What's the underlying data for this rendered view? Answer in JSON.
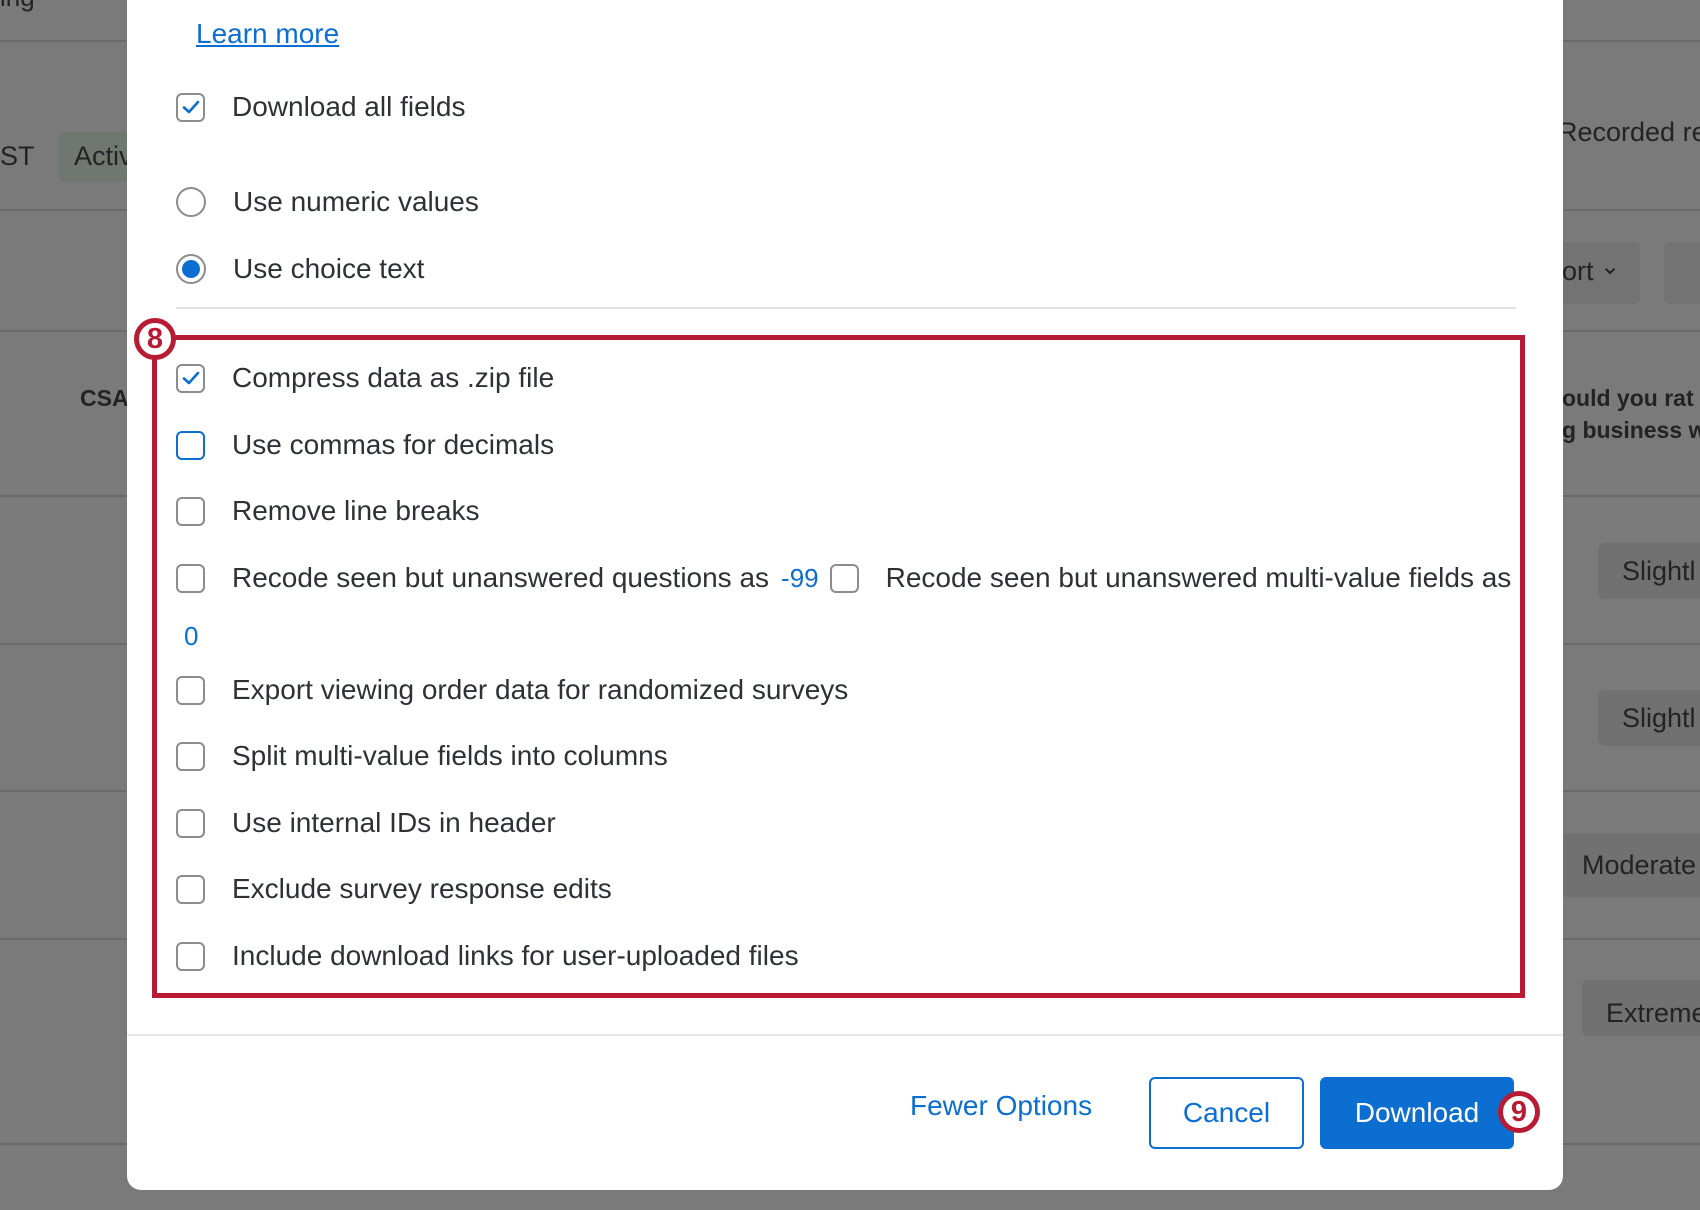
{
  "background": {
    "top_left_fragment": "ing",
    "tab_fragment_1": "ST",
    "status_chip": "Activ",
    "recorded_fragment": "Recorded re",
    "export_fragment": "ort",
    "column_header": "CSA",
    "question_line1": "ould you rat",
    "question_line2": "g business w",
    "answers": [
      "Slightl",
      "Slightl",
      "Moderate",
      "Extreme"
    ]
  },
  "modal": {
    "learn_more": "Learn more",
    "download_all_fields": {
      "label": "Download all fields",
      "checked": true
    },
    "value_options": [
      {
        "label": "Use numeric values",
        "selected": false
      },
      {
        "label": "Use choice text",
        "selected": true
      }
    ],
    "options": {
      "compress_zip": {
        "label": "Compress data as .zip file",
        "checked": true
      },
      "commas_decimals": {
        "label": "Use commas for decimals",
        "checked": false
      },
      "remove_line_breaks": {
        "label": "Remove line breaks",
        "checked": false
      },
      "recode_questions": {
        "label": "Recode seen but unanswered questions as",
        "value": "-99",
        "checked": false
      },
      "recode_multivalue": {
        "label": "Recode seen but unanswered multi-value fields as",
        "value": "0",
        "checked": false
      },
      "viewing_order": {
        "label": "Export viewing order data for randomized surveys",
        "checked": false
      },
      "split_multivalue": {
        "label": "Split multi-value fields into columns",
        "checked": false
      },
      "internal_ids": {
        "label": "Use internal IDs in header",
        "checked": false
      },
      "exclude_edits": {
        "label": "Exclude survey response edits",
        "checked": false
      },
      "download_links": {
        "label": "Include download links for user-uploaded files",
        "checked": false
      }
    },
    "footer": {
      "fewer_options": "Fewer Options",
      "cancel": "Cancel",
      "download": "Download"
    }
  },
  "annotations": {
    "step_8": "8",
    "step_9": "9"
  },
  "colors": {
    "accent": "#0b6ed0",
    "highlight": "#b81c35"
  }
}
